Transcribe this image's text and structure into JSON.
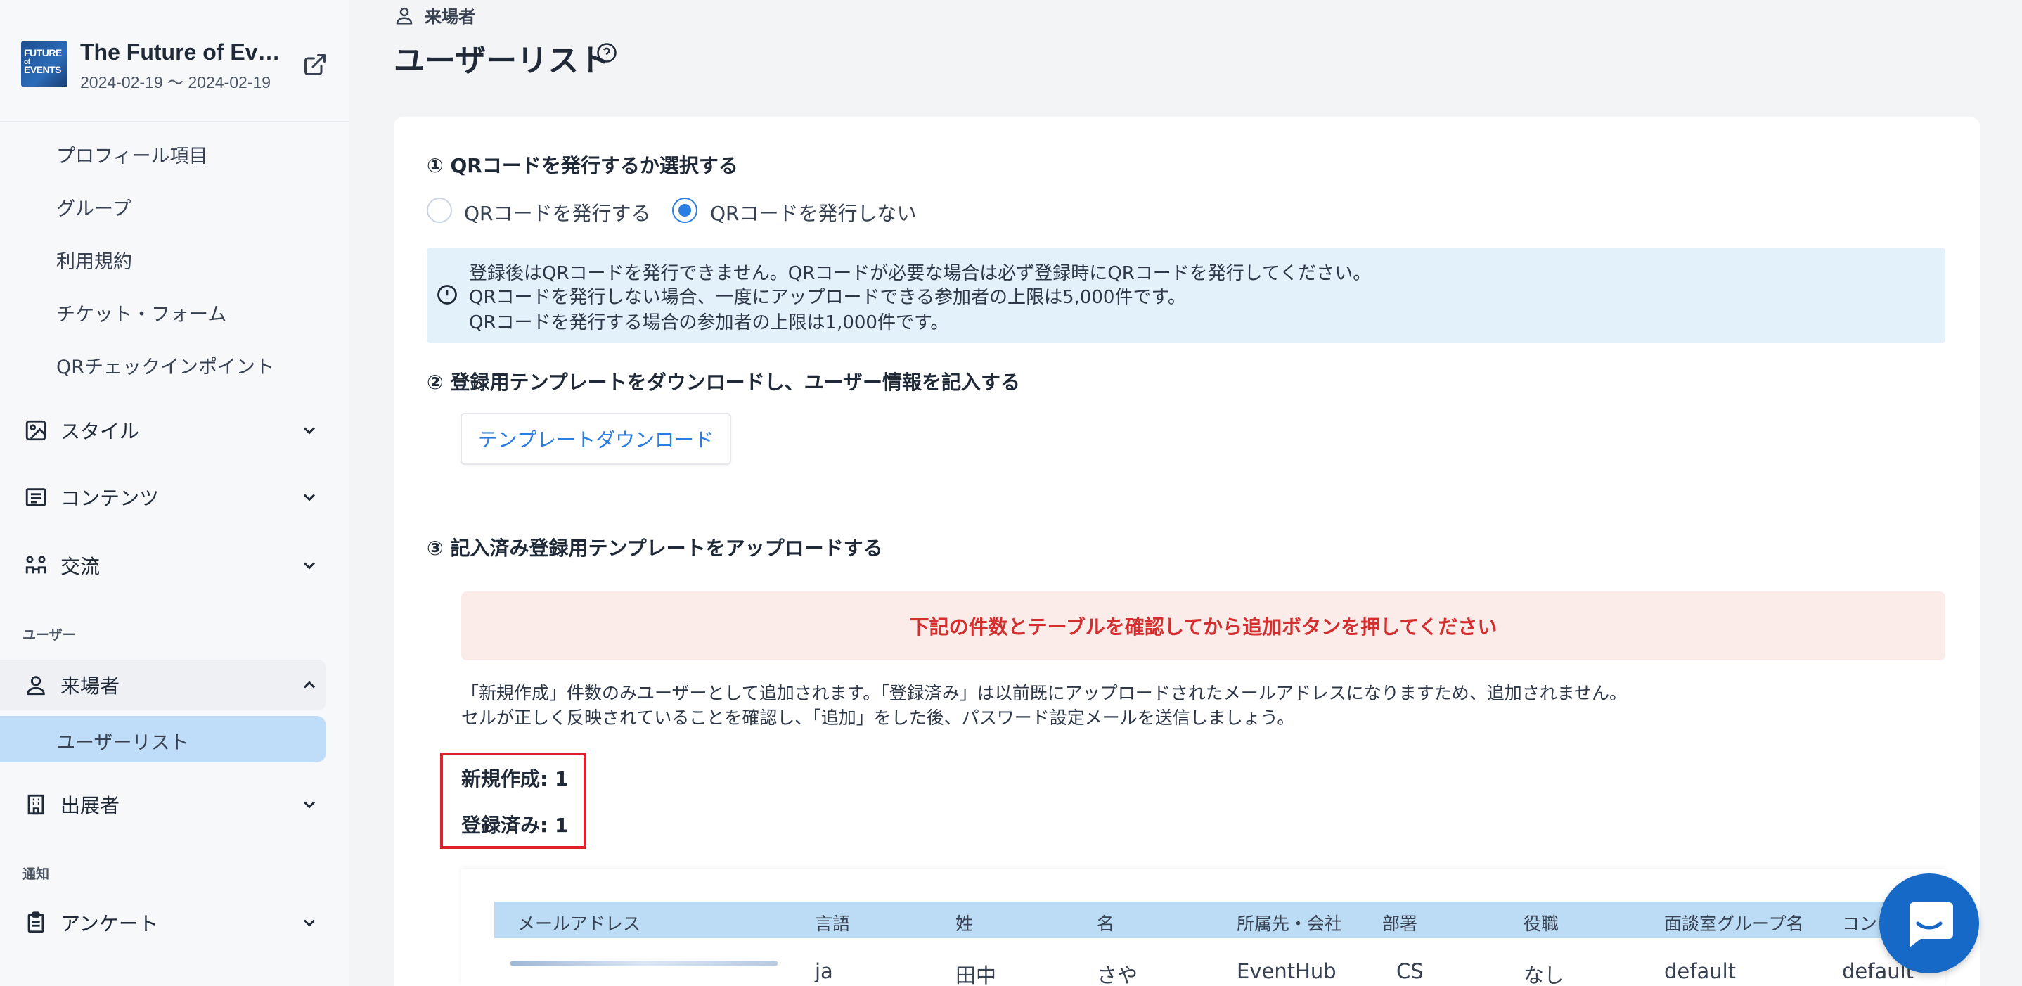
{
  "event": {
    "logo_lines": [
      "FUTURE",
      "of",
      "EVENTS"
    ],
    "title": "The Future of Events",
    "dates": "2024-02-19 〜 2024-02-19"
  },
  "sidebar": {
    "sub_items": [
      "プロフィール項目",
      "グループ",
      "利用規約",
      "チケット・フォーム",
      "QRチェックインポイント"
    ],
    "groups": {
      "style": "スタイル",
      "contents": "コンテンツ",
      "exchange": "交流",
      "visitors": "来場者",
      "exhibitors": "出展者",
      "survey": "アンケート"
    },
    "sections": {
      "users": "ユーザー",
      "notifications": "通知"
    },
    "active_item": "ユーザーリスト"
  },
  "header": {
    "breadcrumb": "来場者",
    "title": "ユーザーリスト"
  },
  "step1": {
    "title": "① QRコードを発行するか選択する",
    "options": [
      "QRコードを発行する",
      "QRコードを発行しない"
    ],
    "selected": "QRコードを発行しない",
    "info": [
      "登録後はQRコードを発行できません。QRコードが必要な場合は必ず登録時にQRコードを発行してください。",
      "QRコードを発行しない場合、一度にアップロードできる参加者の上限は5,000件です。",
      "QRコードを発行する場合の参加者の上限は1,000件です。"
    ]
  },
  "step2": {
    "title": "② 登録用テンプレートをダウンロードし、ユーザー情報を記入する",
    "button": "テンプレートダウンロード"
  },
  "step3": {
    "title": "③ 記入済み登録用テンプレートをアップロードする",
    "warning": "下記の件数とテーブルを確認してから追加ボタンを押してください",
    "notes": [
      "「新規作成」件数のみユーザーとして追加されます。「登録済み」は以前既にアップロードされたメールアドレスになりますため、追加されません。",
      "セルが正しく反映されていることを確認し、「追加」をした後、パスワード設定メールを送信しましょう。"
    ],
    "new_count": "新規作成: 1",
    "registered_count": "登録済み: 1"
  },
  "table": {
    "headers": [
      "メールアドレス",
      "言語",
      "姓",
      "名",
      "所属先・会社",
      "部署",
      "役職",
      "面談室グループ名",
      "コンテ"
    ],
    "rows": [
      [
        "",
        "ja",
        "田中",
        "さや",
        "EventHub",
        "CS",
        "なし",
        "default",
        "default"
      ]
    ]
  },
  "colors": {
    "accent": "#2a7de1",
    "warning": "#d32f2f",
    "highlight_border": "#e0202a"
  }
}
